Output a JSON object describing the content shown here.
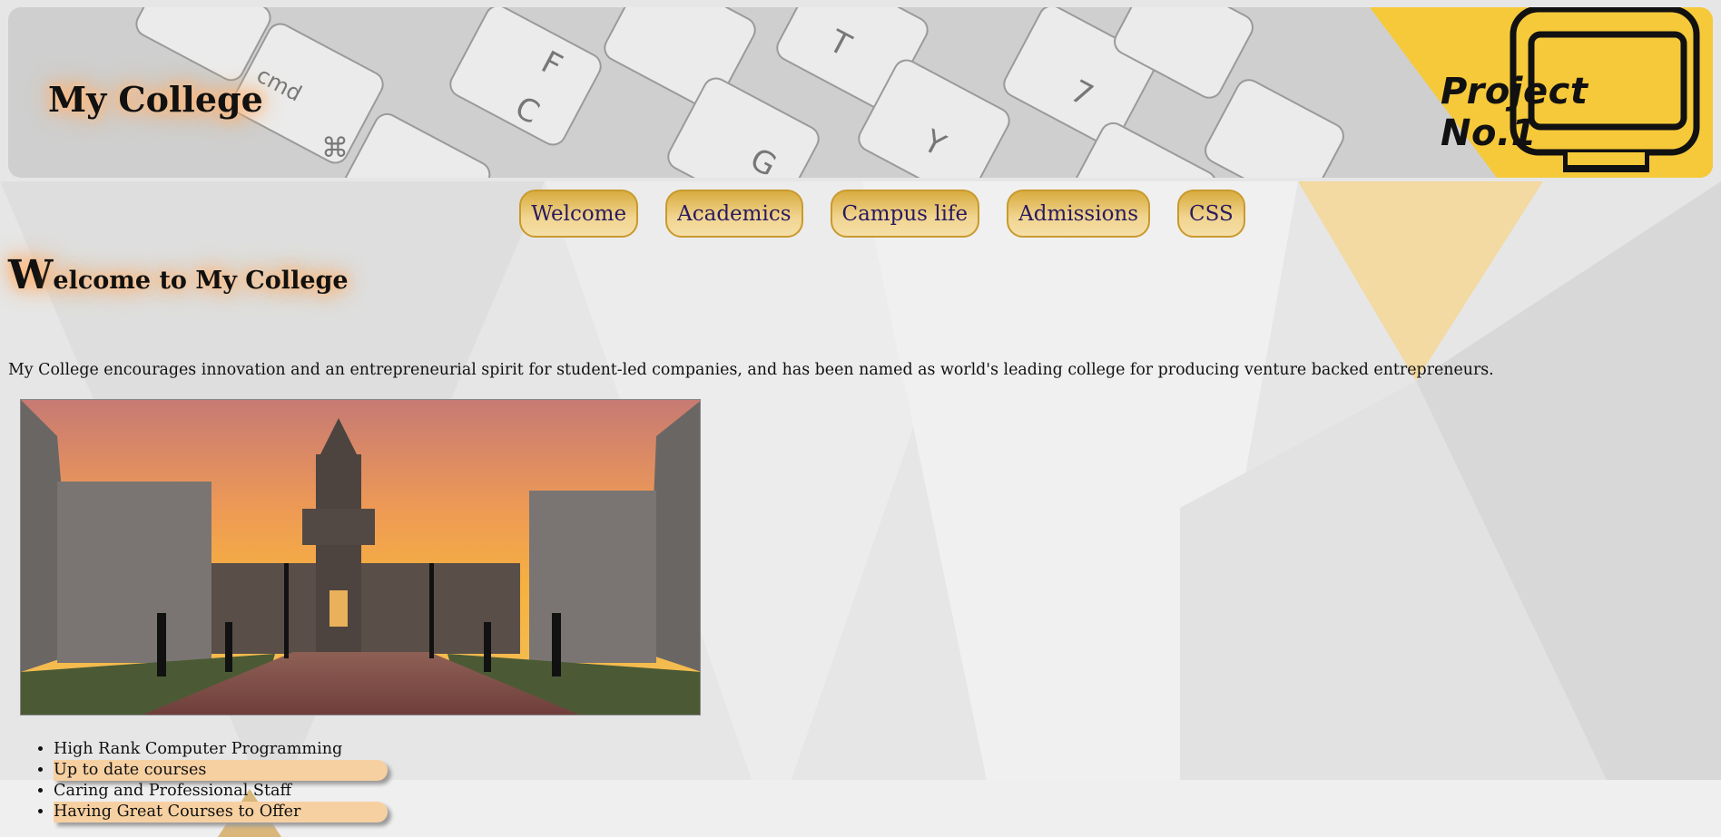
{
  "header": {
    "site_title": "My College",
    "logo_text": "Project No.1"
  },
  "nav": {
    "items": [
      {
        "label": "Welcome"
      },
      {
        "label": "Academics"
      },
      {
        "label": "Campus life"
      },
      {
        "label": "Admissions"
      },
      {
        "label": "CSS"
      }
    ]
  },
  "main": {
    "heading_initial": "W",
    "heading_rest": "elcome to My College",
    "intro": "My College encourages innovation and an entrepreneurial spirit for student-led companies, and has been named as world's leading college for producing venture backed entrepreneurs.",
    "features": [
      {
        "text": "High Rank Computer Programming",
        "highlighted": false
      },
      {
        "text": "Up to date courses",
        "highlighted": true
      },
      {
        "text": "Caring and Professional Staff",
        "highlighted": false
      },
      {
        "text": "Having Great Courses to Offer",
        "highlighted": true
      }
    ]
  },
  "colors": {
    "accent_gold": "#f6c93a",
    "nav_text": "#2a1a5e",
    "highlight": "#f7d0a2"
  }
}
